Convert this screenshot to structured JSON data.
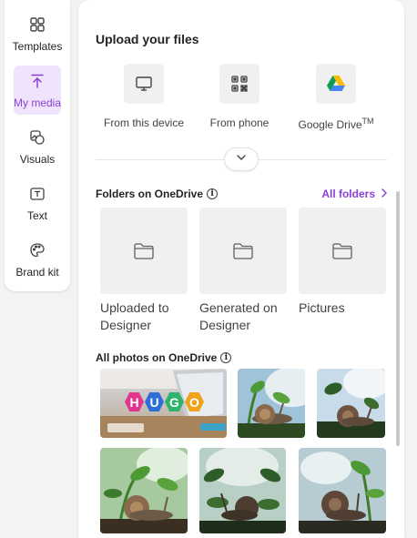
{
  "rail": {
    "items": [
      {
        "label": "Templates",
        "icon": "templates-icon"
      },
      {
        "label": "My media",
        "icon": "upload-icon",
        "active": true
      },
      {
        "label": "Visuals",
        "icon": "visuals-icon"
      },
      {
        "label": "Text",
        "icon": "text-icon"
      },
      {
        "label": "Brand kit",
        "icon": "palette-icon"
      }
    ],
    "accent": "#8b3fd9"
  },
  "upload": {
    "title": "Upload your files",
    "sources": [
      {
        "label": "From this device",
        "icon": "monitor-icon"
      },
      {
        "label": "From phone",
        "icon": "qr-code-icon"
      },
      {
        "label": "Google Drive",
        "trademark": "TM",
        "icon": "google-drive-icon"
      }
    ]
  },
  "folders": {
    "title": "Folders on OneDrive",
    "all_label": "All folders",
    "items": [
      {
        "name": "Uploaded to Designer"
      },
      {
        "name": "Generated on Designer"
      },
      {
        "name": "Pictures"
      }
    ]
  },
  "photos": {
    "title": "All photos on OneDrive",
    "logo_letters": [
      "H",
      "U",
      "G",
      "O"
    ],
    "logo_colors": [
      "#e0368d",
      "#2d6fd6",
      "#2fb36a",
      "#f0a21a"
    ]
  }
}
